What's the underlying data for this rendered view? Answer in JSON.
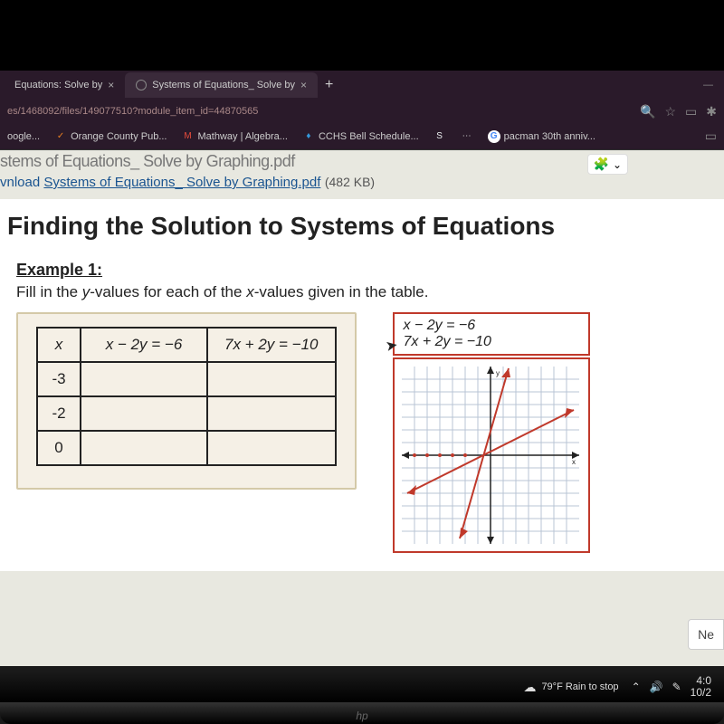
{
  "tabs": {
    "inactive": "Equations: Solve by",
    "active": "Systems of Equations_ Solve by",
    "close": "×",
    "plus": "+",
    "minimize": "—"
  },
  "url": "es/1468092/files/149077510?module_item_id=44870565",
  "bookmarks": {
    "b0": "oogle...",
    "b1": "Orange County Pub...",
    "b2": "Mathway | Algebra...",
    "b3": "CCHS Bell Schedule...",
    "b4": "pacman 30th anniv..."
  },
  "doc": {
    "graytitle": "stems of Equations_ Solve by Graphing.pdf",
    "download_prefix": "vnload ",
    "download_link": "Systems of Equations_ Solve by Graphing.pdf",
    "filesize": "(482 KB)",
    "heading": "Finding the Solution to Systems of Equations",
    "example_label": "Example 1:",
    "example_text_a": "Fill in the ",
    "example_text_b": "y",
    "example_text_c": "-values for each of the ",
    "example_text_d": "x",
    "example_text_e": "-values given in the table."
  },
  "table": {
    "h0": "x",
    "h1_a": "x − 2y = −6",
    "h2_a": "7x + 2y = −10",
    "r0": "-3",
    "r1": "-2",
    "r2": "0"
  },
  "equations": {
    "eq1": "x − 2y = −6",
    "eq2": "7x + 2y = −10"
  },
  "next": "Ne",
  "taskbar": {
    "weather": "79°F Rain to stop",
    "time": "4:0",
    "date": "10/2"
  },
  "icons": {
    "chevron": "⌃",
    "sound": "🔊",
    "edit": "✎",
    "star": "☆",
    "ext": "✱",
    "reading": "▭",
    "puzzle": "🧩",
    "down": "⌄",
    "cloud": "☁",
    "s_icon": "S",
    "g_icon": "G",
    "m_icon": "M",
    "check": "✓",
    "shield": "♦"
  }
}
